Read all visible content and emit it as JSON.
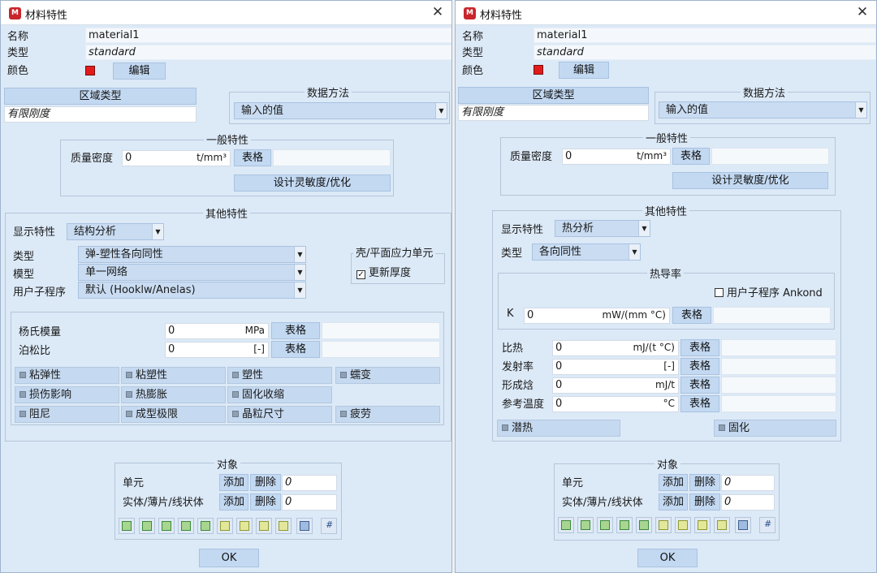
{
  "left": {
    "title": "材料特性",
    "name_label": "名称",
    "name_value": "material1",
    "type_label": "类型",
    "type_value": "standard",
    "color_label": "颜色",
    "edit_button": "编辑",
    "region_type_button": "区域类型",
    "region_type_value": "有限刚度",
    "data_method_title": "数据方法",
    "data_method_value": "输入的值",
    "general_props_title": "一般特性",
    "density_label": "质量密度",
    "density_value": "0",
    "density_unit": "t/mm³",
    "table_label": "表格",
    "design_sensitivity_button": "设计灵敏度/优化",
    "other_props_title": "其他特性",
    "display_props_label": "显示特性",
    "display_props_value": "结构分析",
    "kind_label": "类型",
    "kind_value": "弹-塑性各向同性",
    "model_label": "模型",
    "model_value": "单一网络",
    "user_sub_label": "用户子程序",
    "user_sub_value": "默认 (Hooklw/Anelas)",
    "shell_title": "壳/平面应力单元",
    "update_thickness": "更新厚度",
    "youngs_label": "杨氏模量",
    "youngs_value": "0",
    "youngs_unit": "MPa",
    "poisson_label": "泊松比",
    "poisson_value": "0",
    "poisson_unit": "[-]",
    "options": [
      "粘弹性",
      "粘塑性",
      "塑性",
      "蠕变",
      "损伤影响",
      "热膨胀",
      "固化收缩",
      "阻尼",
      "成型极限",
      "晶粒尺寸",
      "疲劳"
    ],
    "objects_title": "对象",
    "elements_label": "单元",
    "solids_label": "实体/薄片/线状体",
    "add_label": "添加",
    "delete_label": "删除",
    "elements_count": "0",
    "solids_count": "0",
    "ok_label": "OK"
  },
  "right": {
    "title": "材料特性",
    "name_label": "名称",
    "name_value": "material1",
    "type_label": "类型",
    "type_value": "standard",
    "color_label": "颜色",
    "edit_button": "编辑",
    "region_type_button": "区域类型",
    "region_type_value": "有限刚度",
    "data_method_title": "数据方法",
    "data_method_value": "输入的值",
    "general_props_title": "一般特性",
    "density_label": "质量密度",
    "density_value": "0",
    "density_unit": "t/mm³",
    "table_label": "表格",
    "design_sensitivity_button": "设计灵敏度/优化",
    "other_props_title": "其他特性",
    "display_props_label": "显示特性",
    "display_props_value": "热分析",
    "kind_label": "类型",
    "kind_value": "各向同性",
    "conductivity_title": "热导率",
    "user_sub_ankond": "用户子程序 Ankond",
    "k_label": "K",
    "k_value": "0",
    "k_unit": "mW/(mm °C)",
    "specific_heat_label": "比热",
    "specific_heat_value": "0",
    "specific_heat_unit": "mJ/(t °C)",
    "emissivity_label": "发射率",
    "emissivity_value": "0",
    "emissivity_unit": "[-]",
    "formation_enthalpy_label": "形成焓",
    "formation_enthalpy_value": "0",
    "formation_enthalpy_unit": "mJ/t",
    "ref_temp_label": "参考温度",
    "ref_temp_value": "0",
    "ref_temp_unit": "°C",
    "latent_heat": "潜热",
    "curing": "固化",
    "objects_title": "对象",
    "elements_label": "单元",
    "solids_label": "实体/薄片/线状体",
    "add_label": "添加",
    "delete_label": "删除",
    "elements_count": "0",
    "solids_count": "0",
    "ok_label": "OK"
  }
}
